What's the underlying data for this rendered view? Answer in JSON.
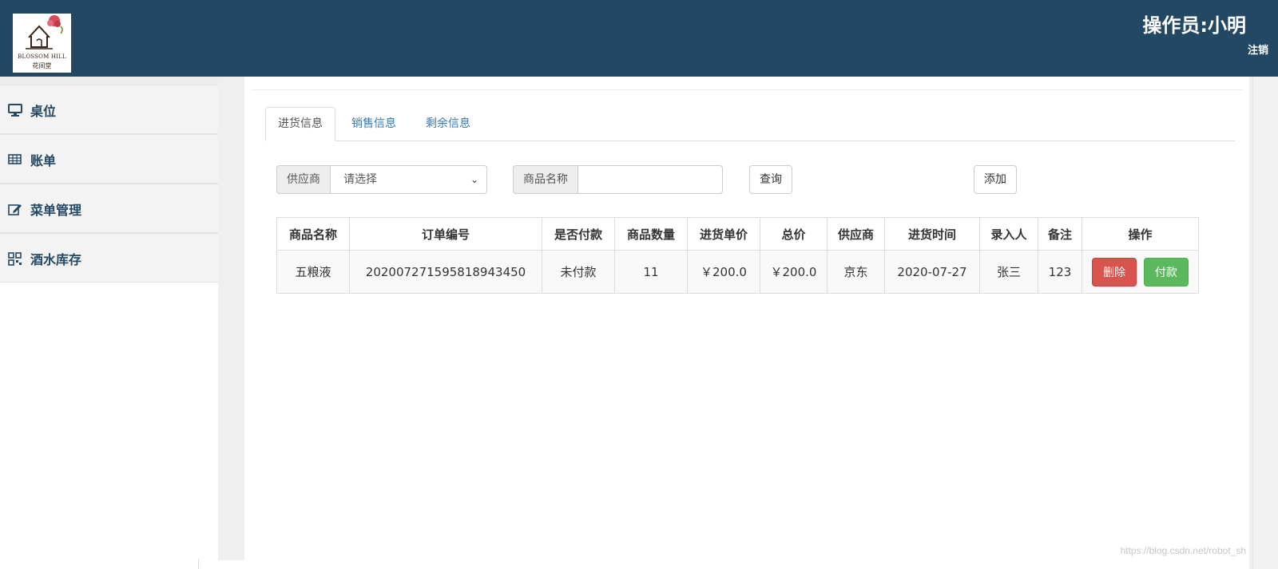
{
  "header": {
    "logo_text_en": "BLOSSOM HILL",
    "logo_text_cn": "花间堂",
    "operator": "操作员:小明",
    "logout": "注销",
    "bg_color": "#234863"
  },
  "sidebar": {
    "items": [
      {
        "label": "桌位",
        "icon": "desktop-icon"
      },
      {
        "label": "账单",
        "icon": "table-icon"
      },
      {
        "label": "菜单管理",
        "icon": "edit-icon"
      },
      {
        "label": "酒水库存",
        "icon": "qrcode-icon"
      }
    ]
  },
  "tabs": [
    {
      "label": "进货信息",
      "active": true
    },
    {
      "label": "销售信息",
      "active": false
    },
    {
      "label": "剩余信息",
      "active": false
    }
  ],
  "filters": {
    "supplier_label": "供应商",
    "supplier_value": "请选择",
    "product_label": "商品名称",
    "product_value": "",
    "query_button": "查询",
    "add_button": "添加"
  },
  "table": {
    "headers": [
      "商品名称",
      "订单编号",
      "是否付款",
      "商品数量",
      "进货单价",
      "总价",
      "供应商",
      "进货时间",
      "录入人",
      "备注",
      "操作"
    ],
    "rows": [
      {
        "cells": [
          "五粮液",
          "20200727159581894345​0",
          "未付款",
          "11",
          "￥200.0",
          "￥200.0",
          "京东",
          "2020-07-27",
          "张三",
          "123"
        ],
        "actions": {
          "delete": "删除",
          "pay": "付款"
        }
      }
    ]
  },
  "watermark": "https://blog.csdn.net/robot_sh",
  "colors": {
    "danger": "#d9534f",
    "success": "#5cb85c",
    "link": "#337ab7"
  }
}
